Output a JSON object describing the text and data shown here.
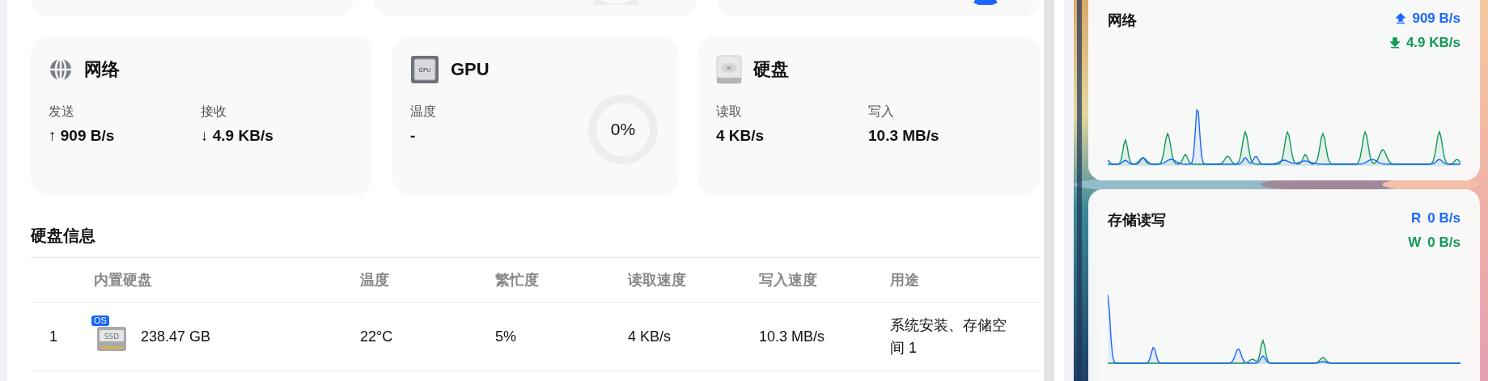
{
  "cards": [
    {
      "kind": "network",
      "title": "网络",
      "stats": [
        {
          "label": "发送",
          "arrow": "↑",
          "value": "909 B/s"
        },
        {
          "label": "接收",
          "arrow": "↓",
          "value": "4.9 KB/s"
        }
      ]
    },
    {
      "kind": "gpu",
      "title": "GPU",
      "icon_text": "GPU",
      "stats": [
        {
          "label": "温度",
          "value": "-"
        }
      ],
      "gauge": {
        "text": "0%",
        "level": 0
      }
    },
    {
      "kind": "disk",
      "title": "硬盘",
      "stats": [
        {
          "label": "读取",
          "value": "4 KB/s"
        },
        {
          "label": "写入",
          "value": "10.3 MB/s"
        }
      ]
    }
  ],
  "disk_info": {
    "title": "硬盘信息",
    "columns": [
      "内置硬盘",
      "温度",
      "繁忙度",
      "读取速度",
      "写入速度",
      "用途"
    ],
    "rows": [
      {
        "index": "1",
        "badge": "OS",
        "icon_text": "SSD",
        "capacity": "238.47 GB",
        "temperature": "22°C",
        "busy": "5%",
        "read": "4 KB/s",
        "write": "10.3 MB/s",
        "usage": "系统安装、存储空间 1"
      }
    ]
  },
  "widgets": [
    {
      "kind": "network",
      "title": "网络",
      "readings": [
        {
          "kind": "upload",
          "value": "909 B/s",
          "color": "#1a66ff"
        },
        {
          "kind": "download",
          "value": "4.9 KB/s",
          "color": "#119955"
        }
      ]
    },
    {
      "kind": "storage",
      "title": "存储读写",
      "readings": [
        {
          "kind": "read",
          "prefix": "R",
          "value": "0 B/s",
          "color": "#1a66ff"
        },
        {
          "kind": "write",
          "prefix": "W",
          "value": "0 B/s",
          "color": "#119955"
        }
      ]
    }
  ]
}
